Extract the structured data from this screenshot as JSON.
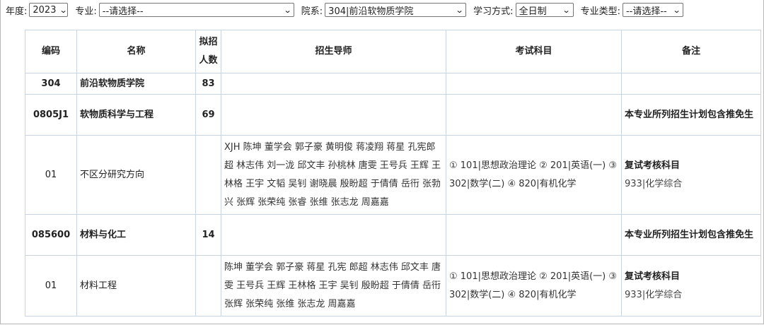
{
  "filters": {
    "year": {
      "label": "年度:",
      "value": "2023"
    },
    "major": {
      "label": "专业:",
      "value": "--请选择--"
    },
    "department": {
      "label": "院系:",
      "value": "304|前沿软物质学院"
    },
    "study_mode": {
      "label": "学习方式:",
      "value": "全日制"
    },
    "major_type": {
      "label": "专业类型:",
      "value": "--请选择--"
    }
  },
  "table": {
    "headers": {
      "code": "编码",
      "name": "名称",
      "quota_line1": "拟招",
      "quota_line2": "人数",
      "advisors": "招生导师",
      "subjects": "考试科目",
      "notes": "备注"
    },
    "rows": [
      {
        "code": "304",
        "name": "前沿软物质学院",
        "quota": "83",
        "advisors": "",
        "subjects": "",
        "note_title": "",
        "note_detail": ""
      },
      {
        "code": "0805J1",
        "name": "软物质科学与工程",
        "quota": "69",
        "advisors": "",
        "subjects": "",
        "note_title": "本专业所列招生计划包含推免生",
        "note_detail": ""
      },
      {
        "code": "01",
        "name": "不区分研究方向",
        "quota": "",
        "advisors": "XJH 陈坤 董学会 郭子豪 黄明俊 蒋凌翔 蒋星 孔宪郎超 林志伟 刘一泷 邱文丰 孙桃林 唐雯 王号兵 王辉 王林格 王宇 文韬 吴钊 谢晓晨 殷盼超 于倩倩 岳衎 张勃兴 张辉 张荣纯 张睿 张维 张志龙 周嘉嘉",
        "subjects": "① 101|思想政治理论 ② 201|英语(一) ③ 302|数学(二) ④ 820|有机化学",
        "note_title": "复试考核科目",
        "note_detail": "933|化学综合"
      },
      {
        "code": "085600",
        "name": "材料与化工",
        "quota": "14",
        "advisors": "",
        "subjects": "",
        "note_title": "本专业所列招生计划包含推免生",
        "note_detail": ""
      },
      {
        "code": "01",
        "name": "材料工程",
        "quota": "",
        "advisors": "陈坤 董学会 郭子豪 蒋星 孔宪 郎超 林志伟 邱文丰 唐雯 王号兵 王辉 王林格 王宇 吴钊 殷盼超 于倩倩 岳衎 张辉 张荣纯 张维 张志龙 周嘉嘉",
        "subjects": "① 101|思想政治理论 ② 201|英语(一) ③ 302|数学(二) ④ 820|有机化学",
        "note_title": "复试考核科目",
        "note_detail": "933|化学综合"
      }
    ]
  }
}
